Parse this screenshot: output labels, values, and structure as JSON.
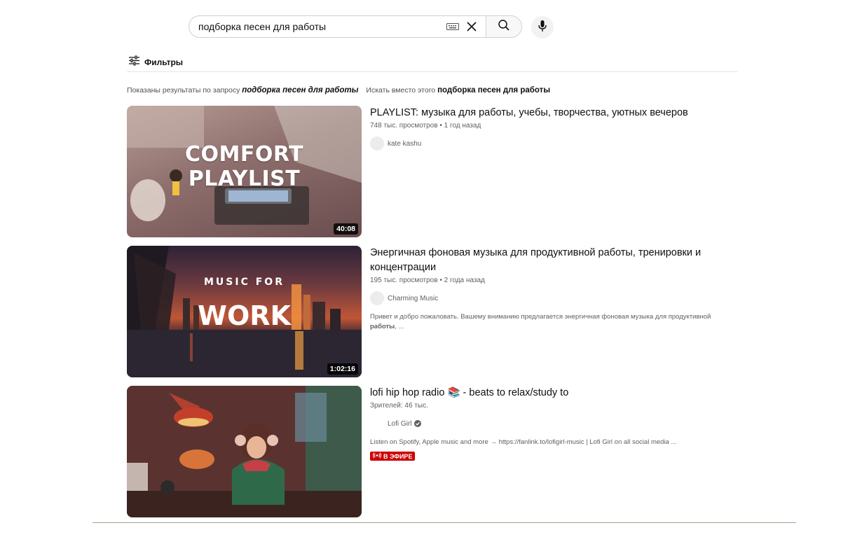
{
  "search": {
    "query": "подборка песен для работы",
    "placeholder": ""
  },
  "icons": {
    "keyboard": "keyboard-icon",
    "clear": "close-icon",
    "search": "search-icon",
    "mic": "mic-icon",
    "filters": "sliders-icon",
    "live": "broadcast-icon",
    "verified": "verified-check-icon"
  },
  "filters": {
    "label": "Фильтры"
  },
  "correction": {
    "shown_prefix": "Показаны результаты по запросу",
    "shown_query": "подборка песен для работы",
    "instead_prefix": "Искать вместо этого",
    "instead_query": "подборка песен для работы"
  },
  "results": [
    {
      "title": "PLAYLIST: музыка для работы, учебы, творчества, уютных вечеров",
      "meta": "748 тыс. просмотров • 1 год назад",
      "channel": "kate kashu",
      "duration": "40:08",
      "thumb_text": "COMFORT PLAYLIST"
    },
    {
      "title": "Энергичная фоновая музыка для продуктивной работы, тренировки и концентрации",
      "meta": "195 тыс. просмотров • 2 года назад",
      "channel": "Charming Music",
      "description": "Привет и добро пожаловать. Вашему вниманию предлагается энергичная фоновая музыка для продуктивной",
      "description_bold": "работы",
      "description_tail": ", ...",
      "duration": "1:02:16",
      "thumb_text_small": "MUSIC FOR",
      "thumb_text_big": "WORK"
    },
    {
      "title_part1": "lofi hip hop radio",
      "title_emoji": "📚",
      "title_part2": "- beats to relax/study to",
      "meta": "Зрителей: 46 тыс.",
      "channel": "Lofi Girl",
      "description": "Listen on Spotify, Apple music and more → https://fanlink.to/lofigirl-music | Lofi Girl on all social media ...",
      "live_badge": "В ЭФИРЕ"
    }
  ],
  "colors": {
    "live_red": "#cc0000",
    "text_primary": "#0f0f0f",
    "text_secondary": "#606060"
  }
}
